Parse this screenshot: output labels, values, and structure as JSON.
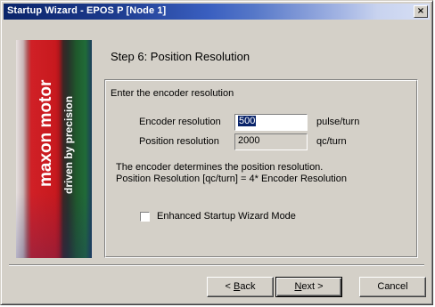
{
  "window": {
    "title": "Startup Wizard - EPOS P [Node 1]",
    "close_glyph": "×"
  },
  "banner": {
    "brand": "maxon motor",
    "tagline": "driven by precision"
  },
  "step": {
    "title": "Step 6: Position Resolution"
  },
  "group": {
    "instruction": "Enter the encoder resolution",
    "encoder_resolution": {
      "label": "Encoder resolution",
      "value": "500",
      "unit": "pulse/turn"
    },
    "position_resolution": {
      "label": "Position resolution",
      "value": "2000",
      "unit": "qc/turn"
    },
    "description_line1": "The encoder determines the position resolution.",
    "description_line2": "Position Resolution [qc/turn] = 4* Encoder Resolution",
    "enhanced_mode": {
      "label": "Enhanced Startup Wizard Mode",
      "checked": false
    }
  },
  "buttons": {
    "back": {
      "prefix": "< ",
      "mnemonic": "B",
      "rest": "ack"
    },
    "next": {
      "mnemonic": "N",
      "rest": "ext >"
    },
    "cancel": "Cancel"
  },
  "colors": {
    "title_bar_start": "#0a246a",
    "face": "#d4d0c8",
    "brand_red": "#c8191e"
  }
}
